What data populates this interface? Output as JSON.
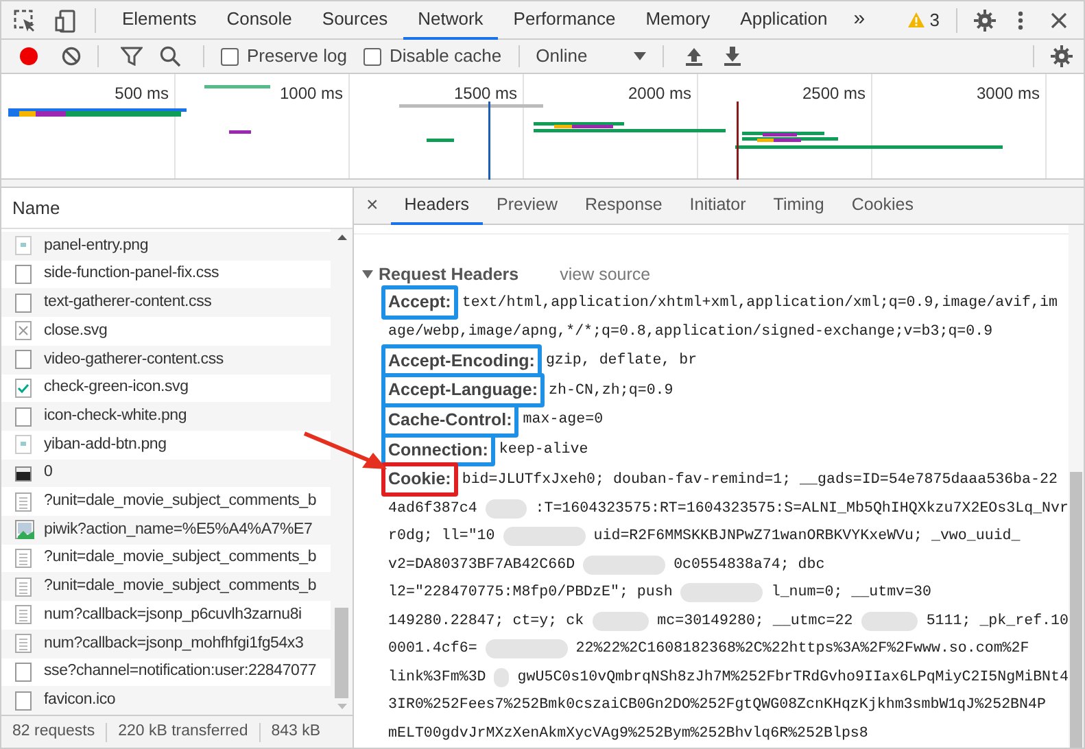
{
  "main_tabs": [
    {
      "label": "Elements",
      "selected": false
    },
    {
      "label": "Console",
      "selected": false
    },
    {
      "label": "Sources",
      "selected": false
    },
    {
      "label": "Network",
      "selected": true
    },
    {
      "label": "Performance",
      "selected": false
    },
    {
      "label": "Memory",
      "selected": false
    },
    {
      "label": "Application",
      "selected": false
    }
  ],
  "more_tabs": "»",
  "warnings": "3",
  "toolbar": {
    "recording": true,
    "preserve_log": {
      "label": "Preserve log",
      "checked": false
    },
    "disable_cache": {
      "label": "Disable cache",
      "checked": false
    },
    "throttling": "Online"
  },
  "timeline": {
    "ticks": [
      "500 ms",
      "1000 ms",
      "1500 ms",
      "2000 ms",
      "2500 ms",
      "3000 ms"
    ]
  },
  "requests": {
    "column": "Name",
    "rows": [
      {
        "name": "panel-entry.png",
        "kind": "image-small"
      },
      {
        "name": "side-function-panel-fix.css",
        "kind": "blank"
      },
      {
        "name": "text-gatherer-content.css",
        "kind": "blank"
      },
      {
        "name": "close.svg",
        "kind": "cross"
      },
      {
        "name": "video-gatherer-content.css",
        "kind": "blank"
      },
      {
        "name": "check-green-icon.svg",
        "kind": "check"
      },
      {
        "name": "icon-check-white.png",
        "kind": "blank"
      },
      {
        "name": "yiban-add-btn.png",
        "kind": "image-small"
      },
      {
        "name": "0",
        "kind": "image-dark"
      },
      {
        "name": "?unit=dale_movie_subject_comments_b",
        "kind": "doc"
      },
      {
        "name": "piwik?action_name=%E5%A4%A7%E7",
        "kind": "picture"
      },
      {
        "name": "?unit=dale_movie_subject_comments_b",
        "kind": "doc"
      },
      {
        "name": "?unit=dale_movie_subject_comments_b",
        "kind": "doc"
      },
      {
        "name": "num?callback=jsonp_p6cuvlh3zarnu8i",
        "kind": "doc"
      },
      {
        "name": "num?callback=jsonp_mohfhfgi1fg54x3",
        "kind": "doc"
      },
      {
        "name": "sse?channel=notification:user:22847077",
        "kind": "blank"
      },
      {
        "name": "favicon.ico",
        "kind": "blank"
      }
    ],
    "summary": [
      "82 requests",
      "220 kB transferred",
      "843 kB"
    ]
  },
  "detail_tabs": [
    {
      "label": "Headers",
      "selected": true
    },
    {
      "label": "Preview",
      "selected": false
    },
    {
      "label": "Response",
      "selected": false
    },
    {
      "label": "Initiator",
      "selected": false
    },
    {
      "label": "Timing",
      "selected": false
    },
    {
      "label": "Cookies",
      "selected": false
    }
  ],
  "close": "×",
  "request_headers": {
    "title": "Request Headers",
    "view_source": "view source",
    "expanded": true,
    "headers": [
      {
        "name": "Accept:",
        "color": "#1e90e6",
        "lines": [
          [
            "text/html,application/xhtml+xml,application/xml;q=0.9,image/avif,im"
          ],
          [
            "age/webp,image/apng,*/*;q=0.8,application/signed-exchange;v=b3;q=0.9"
          ]
        ]
      },
      {
        "name": "Accept-Encoding:",
        "color": "#1e90e6",
        "lines": [
          [
            "gzip, deflate, br"
          ]
        ]
      },
      {
        "name": "Accept-Language:",
        "color": "#1e90e6",
        "lines": [
          [
            "zh-CN,zh;q=0.9"
          ]
        ]
      },
      {
        "name": "Cache-Control:",
        "color": "#1e90e6",
        "lines": [
          [
            "max-age=0"
          ]
        ]
      },
      {
        "name": "Connection:",
        "color": "#1e90e6",
        "lines": [
          [
            "keep-alive"
          ]
        ]
      },
      {
        "name": "Cookie:",
        "color": "#e02020",
        "lines": [
          [
            "bid=JLUTfxJxeh0; douban-fav-remind=1; __gads=ID=54e7875daaa536ba-22"
          ],
          [
            "4ad6f387c4",
            ":T=1604323575:RT=1604323575:S=ALNI_Mb5QhIHQXkzu7X2EOs3Lq_Nvr"
          ],
          [
            "r0dg; ll=\"10",
            "uid=R2F6MMSKKBJNPwZ71wanORBKVYKxeWVu; _vwo_uuid_"
          ],
          [
            "v2=DA80373BF7AB42C66D",
            "0c0554838a74; dbc"
          ],
          [
            "l2=\"228470775:M8fp0/PBDzE\"; push",
            "l_num=0; __utmv=30"
          ],
          [
            "149280.22847; ct=y; ck",
            "mc=30149280; __utmc=22",
            "5111; _pk_ref.10"
          ],
          [
            "0001.4cf6=",
            "22%22%2C1608182368%2C%22https%3A%2F%2Fwww.so.com%2F"
          ],
          [
            "link%3Fm%3D",
            "gwU5C0s10vQmbrqNSh8zJh7M%252FbrTRdGvho9IIax6LPqMiyC2I5NgMiBNt4"
          ],
          [
            "3IR0%252Fees7%252Bmk0cszaiCB0Gn2DO%252FgtQWG08ZcnKHqzKjkhm3smbW1qJ%252BN4P"
          ],
          [
            "mELT00gdvJrMXzXenAkmXycVAg9%252Bym%252Bhvlq6R%252Blps8"
          ]
        ]
      }
    ]
  }
}
